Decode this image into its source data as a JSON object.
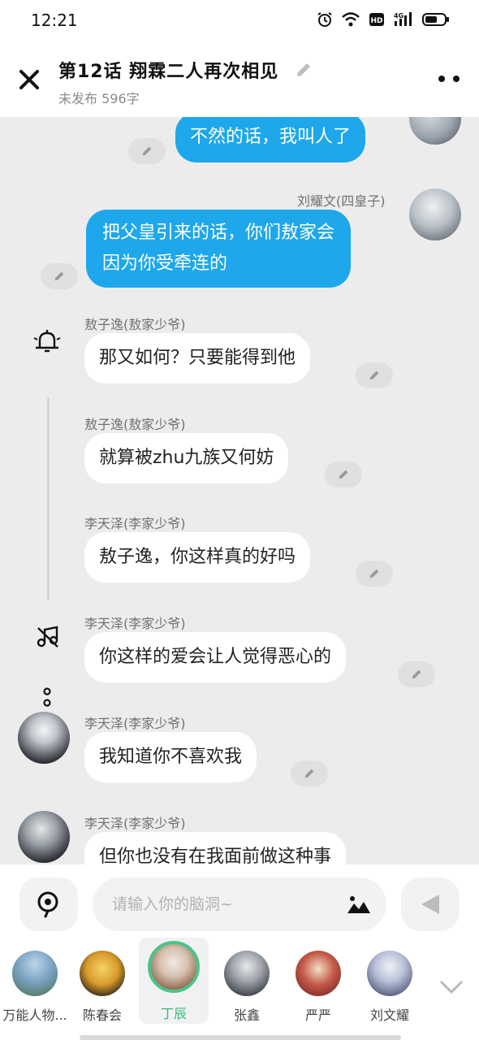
{
  "status": {
    "time": "12:21"
  },
  "header": {
    "title": "第12话  翔霖二人再次相见",
    "subtitle": "未发布 596字"
  },
  "messages": [
    {
      "side": "right",
      "speaker": "",
      "text": "不然的话，我叫人了"
    },
    {
      "side": "right",
      "speaker": "刘耀文(四皇子)",
      "text_line1": "把父皇引来的话，你们敖家会",
      "text_line2": "因为你受牵连的"
    },
    {
      "side": "left",
      "speaker": "敖子逸(敖家少爷)",
      "text": "那又如何？只要能得到他"
    },
    {
      "side": "left",
      "speaker": "敖子逸(敖家少爷)",
      "text": "就算被zhu九族又何妨"
    },
    {
      "side": "left",
      "speaker": "李天泽(李家少爷)",
      "text": "敖子逸，你这样真的好吗"
    },
    {
      "side": "left",
      "speaker": "李天泽(李家少爷)",
      "text": "你这样的爱会让人觉得恶心的"
    },
    {
      "side": "left",
      "speaker": "李天泽(李家少爷)",
      "text": "我知道你不喜欢我"
    },
    {
      "side": "left",
      "speaker": "李天泽(李家少爷)",
      "text": "但你也没有在我面前做这种事"
    }
  ],
  "input": {
    "placeholder": "请输入你的脑洞~",
    "value": ""
  },
  "characters": [
    {
      "name": "万能人物...",
      "selected": false
    },
    {
      "name": "陈春会",
      "selected": false
    },
    {
      "name": "丁辰",
      "selected": true
    },
    {
      "name": "张鑫",
      "selected": false
    },
    {
      "name": "严严",
      "selected": false
    },
    {
      "name": "刘文耀",
      "selected": false
    }
  ],
  "colors": {
    "bubble_right": "#1ea7ea",
    "selected": "#4cc38a",
    "chat_bg": "#ececed"
  }
}
